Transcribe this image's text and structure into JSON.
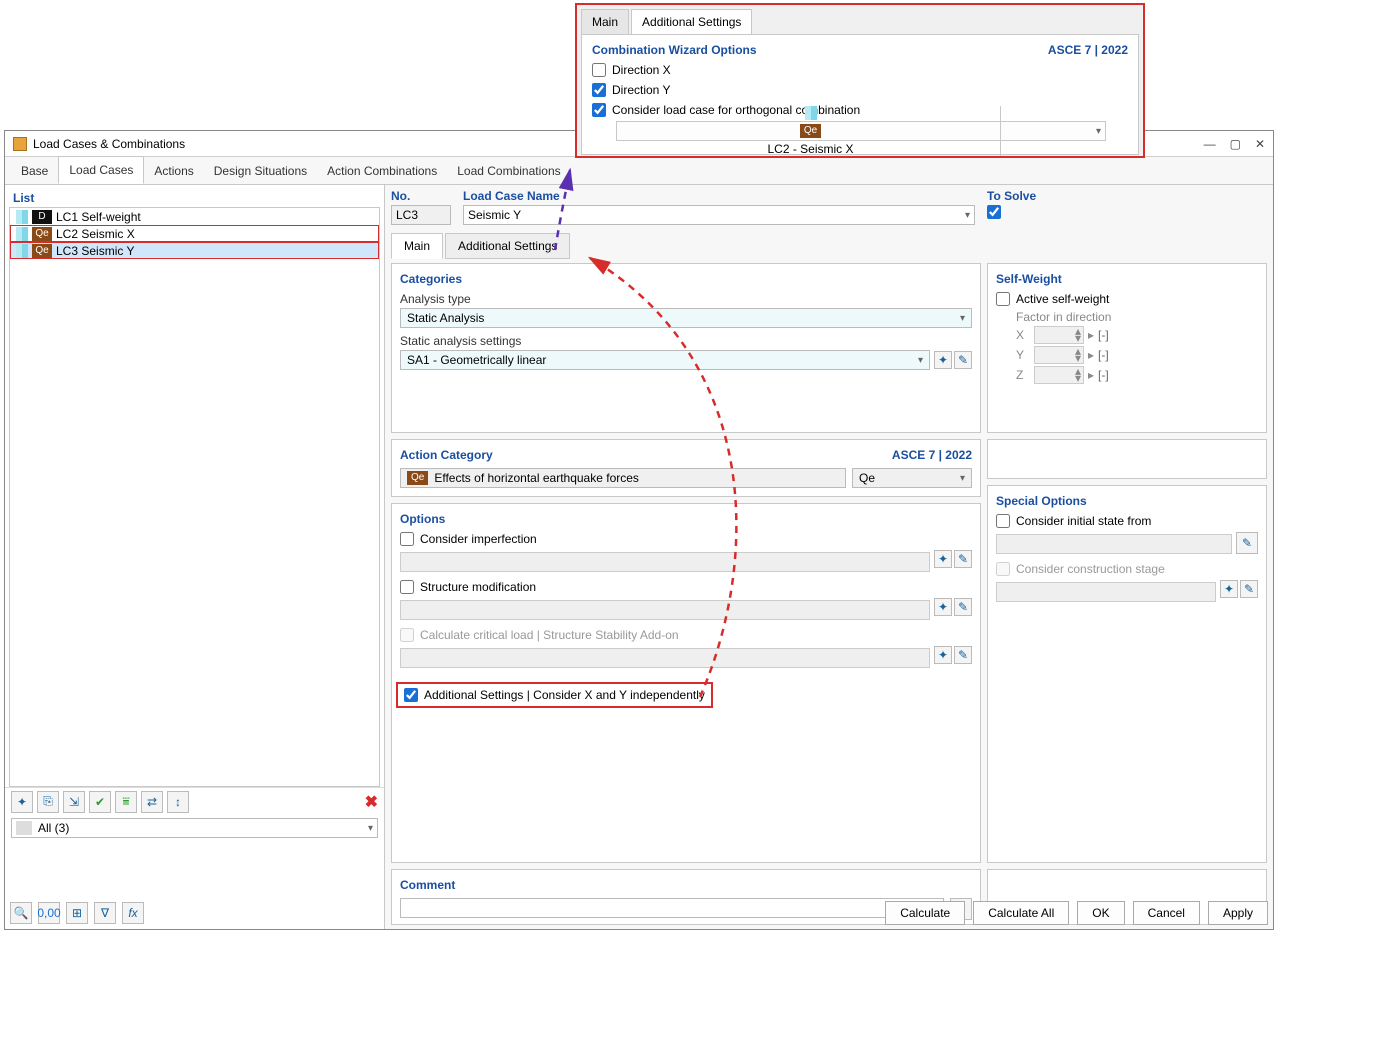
{
  "callout": {
    "tab_main": "Main",
    "tab_add": "Additional Settings",
    "header": "Combination Wizard Options",
    "standard": "ASCE 7 | 2022",
    "dir_x": "Direction X",
    "dir_y": "Direction Y",
    "consider": "Consider load case for orthogonal combination",
    "combo_badge": "Qe",
    "combo_text": "LC2 - Seismic X"
  },
  "window": {
    "title": "Load Cases & Combinations",
    "tabs": [
      "Base",
      "Load Cases",
      "Actions",
      "Design Situations",
      "Action Combinations",
      "Load Combinations"
    ],
    "active_tab": 1
  },
  "list": {
    "title": "List",
    "rows": [
      {
        "code": "D",
        "code_bg": "#111",
        "name": "LC1  Self-weight",
        "sel": false,
        "hl": false
      },
      {
        "code": "Qe",
        "code_bg": "#8a4a17",
        "name": "LC2  Seismic X",
        "sel": false,
        "hl": true
      },
      {
        "code": "Qe",
        "code_bg": "#8a4a17",
        "name": "LC3  Seismic Y",
        "sel": true,
        "hl": true
      }
    ],
    "filter": "All (3)"
  },
  "detail": {
    "no_label": "No.",
    "no_value": "LC3",
    "name_label": "Load Case Name",
    "name_value": "Seismic Y",
    "solve_label": "To Solve",
    "tab_main": "Main",
    "tab_add": "Additional Settings",
    "categories": "Categories",
    "analysis_type_label": "Analysis type",
    "analysis_type": "Static Analysis",
    "sas_label": "Static analysis settings",
    "sas": "SA1 - Geometrically linear",
    "action_cat": "Action Category",
    "action_std": "ASCE 7 | 2022",
    "action_badge": "Qe",
    "action_text": "Effects of horizontal earthquake forces",
    "action_code": "Qe",
    "options": "Options",
    "opt_imperf": "Consider imperfection",
    "opt_struct": "Structure modification",
    "opt_crit": "Calculate critical load | Structure Stability Add-on",
    "opt_additional": "Additional Settings | Consider X and Y independently",
    "selfweight": "Self-Weight",
    "active_sw": "Active self-weight",
    "factor_dir": "Factor in direction",
    "axes": [
      "X",
      "Y",
      "Z"
    ],
    "special": "Special Options",
    "sp_initial": "Consider initial state from",
    "sp_constr": "Consider construction stage",
    "comment": "Comment"
  },
  "buttons": {
    "calculate": "Calculate",
    "calc_all": "Calculate All",
    "ok": "OK",
    "cancel": "Cancel",
    "apply": "Apply"
  }
}
